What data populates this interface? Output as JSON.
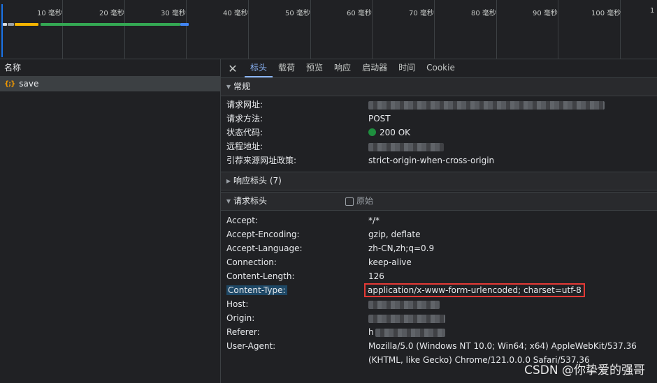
{
  "timeline": {
    "ticks": [
      "10 毫秒",
      "20 毫秒",
      "30 毫秒",
      "40 毫秒",
      "50 毫秒",
      "60 毫秒",
      "70 毫秒",
      "80 毫秒",
      "90 毫秒",
      "100 毫秒",
      "1"
    ]
  },
  "left": {
    "header": "名称",
    "requests": [
      {
        "icon": "{;}",
        "name": "save"
      }
    ]
  },
  "tabs": [
    "标头",
    "载荷",
    "预览",
    "响应",
    "启动器",
    "时间",
    "Cookie"
  ],
  "general": {
    "title": "常规",
    "rows": [
      {
        "key": "请求网址:",
        "value": ""
      },
      {
        "key": "请求方法:",
        "value": "POST"
      },
      {
        "key": "状态代码:",
        "value": "200 OK"
      },
      {
        "key": "远程地址:",
        "value": ""
      },
      {
        "key": "引荐来源网址政策:",
        "value": "strict-origin-when-cross-origin"
      }
    ]
  },
  "response_headers": {
    "title": "响应标头 (7)"
  },
  "request_headers": {
    "title": "请求标头",
    "raw_label": "原始",
    "rows": [
      {
        "key": "Accept:",
        "value": "*/*"
      },
      {
        "key": "Accept-Encoding:",
        "value": "gzip, deflate"
      },
      {
        "key": "Accept-Language:",
        "value": "zh-CN,zh;q=0.9"
      },
      {
        "key": "Connection:",
        "value": "keep-alive"
      },
      {
        "key": "Content-Length:",
        "value": "126"
      },
      {
        "key": "Content-Type:",
        "value": "application/x-www-form-urlencoded; charset=utf-8"
      },
      {
        "key": "Host:",
        "value": ""
      },
      {
        "key": "Origin:",
        "value": ""
      },
      {
        "key": "Referer:",
        "value": "h"
      },
      {
        "key": "User-Agent:",
        "value": "Mozilla/5.0 (Windows NT 10.0; Win64; x64) AppleWebKit/537.36 (KHTML, like Gecko) Chrome/121.0.0.0 Safari/537.36"
      }
    ]
  },
  "watermark": "CSDN @你挚爱的强哥",
  "colors": {
    "accent": "#8ab4f8",
    "status_ok": "#1e8e3e",
    "highlight_box": "#e53935",
    "selection": "#1e4866"
  }
}
